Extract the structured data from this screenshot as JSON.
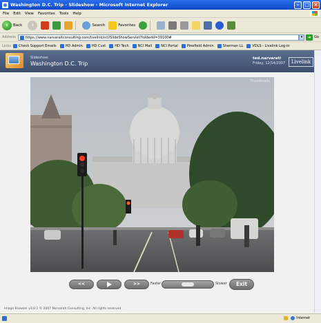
{
  "window": {
    "title": "Washington D.C. Trip - Slideshow - Microsoft Internet Explorer"
  },
  "menu": [
    "File",
    "Edit",
    "View",
    "Favorites",
    "Tools",
    "Help"
  ],
  "toolbar": {
    "back": "Back",
    "search": "Search",
    "favorites": "Favorites"
  },
  "address": {
    "label": "Address",
    "url": "https://www.narvaraitconsulting.com/livelink/ncl/SlideShowServlet?folderId=39100#",
    "go": "Go"
  },
  "links": {
    "label": "Links",
    "items": [
      "Check Support Emails",
      "HD Admin",
      "HD Cust",
      "HD Tech",
      "NCI Mail",
      "NCI Portal",
      "Pinefield Admin",
      "Sherman LL",
      "VDLS - Livelink Log-in"
    ]
  },
  "header": {
    "section": "Slideshow:",
    "album": "Washington D.C. Trip",
    "user": "ted.narvarati",
    "date": "Friday, 12/14/2007",
    "brand": "Livelink"
  },
  "photo": {
    "watermark": "Thumbnails"
  },
  "controls": {
    "prev": "<<",
    "next": ">>",
    "faster": "Faster",
    "slower": "Slower",
    "exit": "Exit",
    "speed_level": 0.5
  },
  "footer": "Image Browser v3.0.1 © 2007  Narvarah Consulting, Inc. All rights reserved.",
  "status": {
    "zone": "Internet"
  },
  "colors": {
    "titlebar": "#0d48c9",
    "header": "#4a5b7a",
    "button": "#7f7f7f"
  }
}
